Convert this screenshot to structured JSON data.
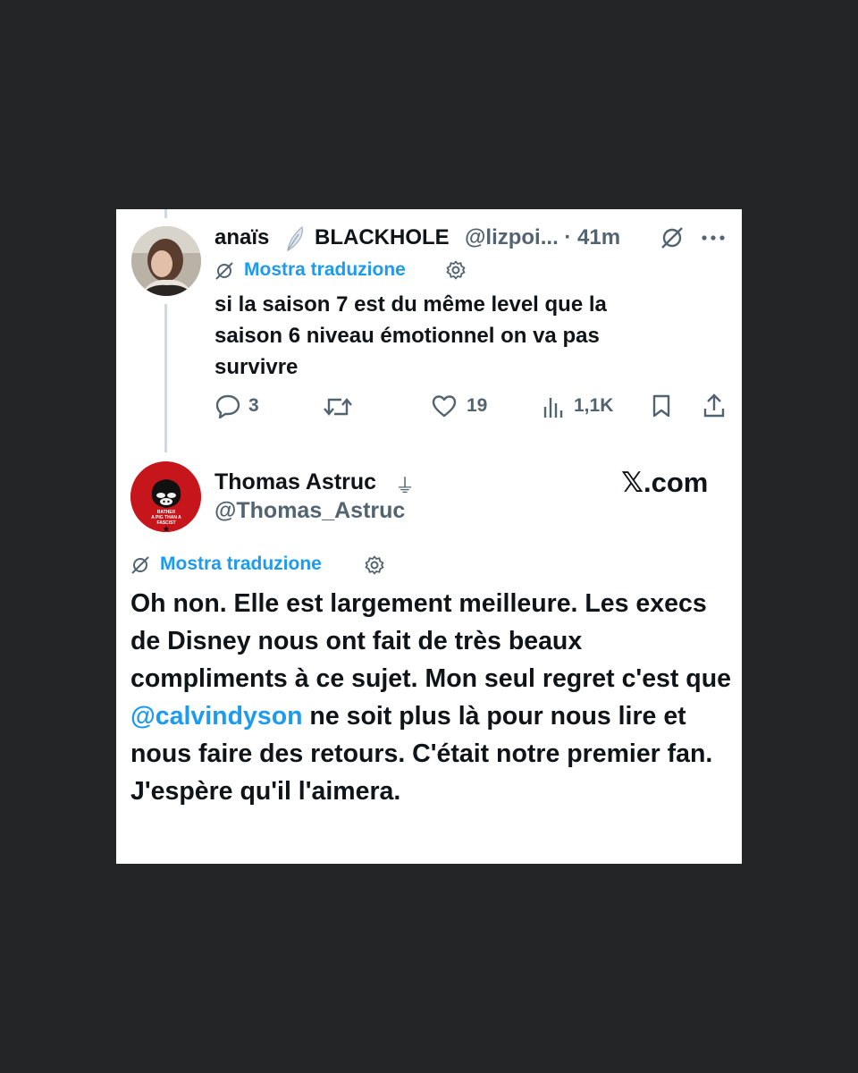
{
  "reply_tweet": {
    "display_name": "anaïs",
    "name_suffix": "BLACKHOLE",
    "handle_time": "@lizpoi... · 41m",
    "translate_label": "Mostra traduzione",
    "text": "si la saison 7 est du même level que la saison 6 niveau émotionnel on va pas survivre",
    "actions": {
      "replies": "3",
      "likes": "19",
      "views": "1,1K"
    }
  },
  "main_tweet": {
    "display_name": "Thomas Astruc",
    "name_symbol": "⏚",
    "handle": "@Thomas_Astruc",
    "brand": "𝕏.com",
    "avatar_text": [
      "RATHER",
      "A PIG THAN A",
      "FASCIST"
    ],
    "translate_label": "Mostra traduzione",
    "text_before_mention": "Oh non. Elle est largement meilleure. Les execs de Disney nous ont fait de très beaux compliments à ce sujet. Mon seul regret c'est que ",
    "mention": "@calvindyson",
    "text_after_mention": " ne soit plus là pour nous lire et nous faire des retours. C'était notre premier fan. J'espère qu'il l'aimera."
  },
  "colors": {
    "background": "#242526",
    "card": "#ffffff",
    "link": "#1d9bf0",
    "muted": "#536471",
    "text": "#0f1419",
    "avatar_red": "#c6161c"
  }
}
